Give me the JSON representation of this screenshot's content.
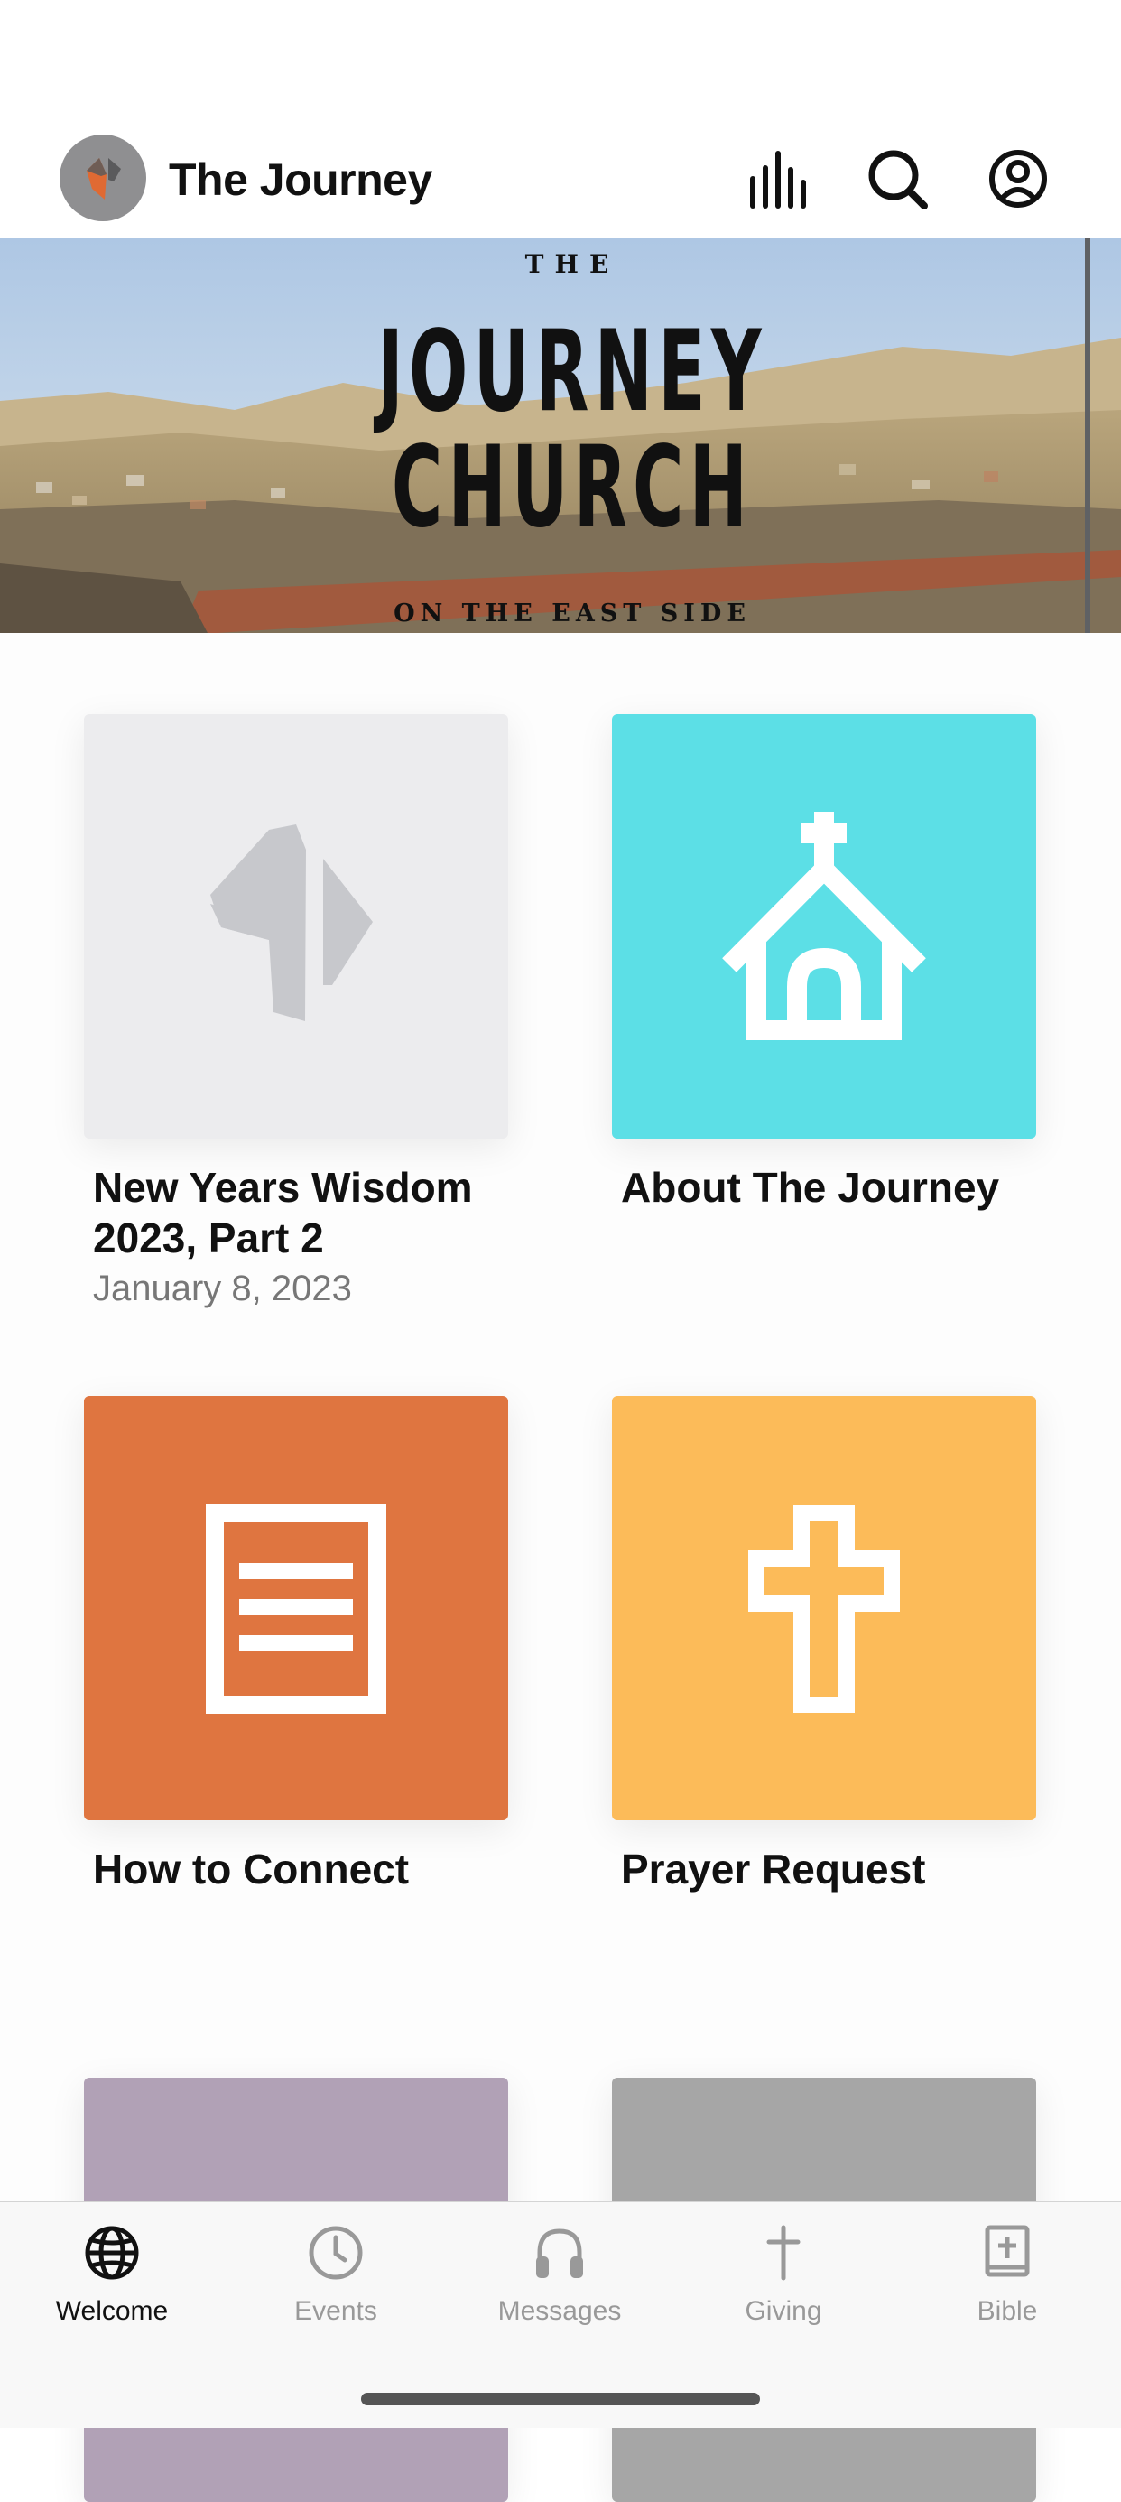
{
  "header": {
    "title": "The Journey",
    "icons": [
      "logo-icon",
      "audio-bars-icon",
      "search-icon",
      "account-icon"
    ]
  },
  "hero": {
    "line_top": "THE",
    "line_1": "JOURNEY",
    "line_2": "CHURCH",
    "line_bottom": "ON THE EAST SIDE"
  },
  "tiles": [
    {
      "title_line1": "New Years Wisdom",
      "title_line2": "2023, Part 2",
      "date": "January 8, 2023",
      "icon": "church-logo-icon",
      "color": "#ececee"
    },
    {
      "title": "About The Journey",
      "icon": "chapel-icon",
      "color": "#5cdfe6"
    },
    {
      "title": "How to Connect",
      "icon": "document-icon",
      "color": "#df7540"
    },
    {
      "title": "Prayer Request",
      "icon": "cross-icon",
      "color": "#fcbb59"
    },
    {
      "title": "",
      "icon": "",
      "color": "#b1a1b6"
    },
    {
      "title": "",
      "icon": "",
      "color": "#a6a6a6"
    }
  ],
  "tabs": [
    {
      "label": "Welcome",
      "icon": "globe-icon",
      "active": true
    },
    {
      "label": "Events",
      "icon": "clock-icon",
      "active": false
    },
    {
      "label": "Messages",
      "icon": "headphones-icon",
      "active": false
    },
    {
      "label": "Giving",
      "icon": "cross-icon",
      "active": false
    },
    {
      "label": "Bible",
      "icon": "bible-icon",
      "active": false
    }
  ]
}
